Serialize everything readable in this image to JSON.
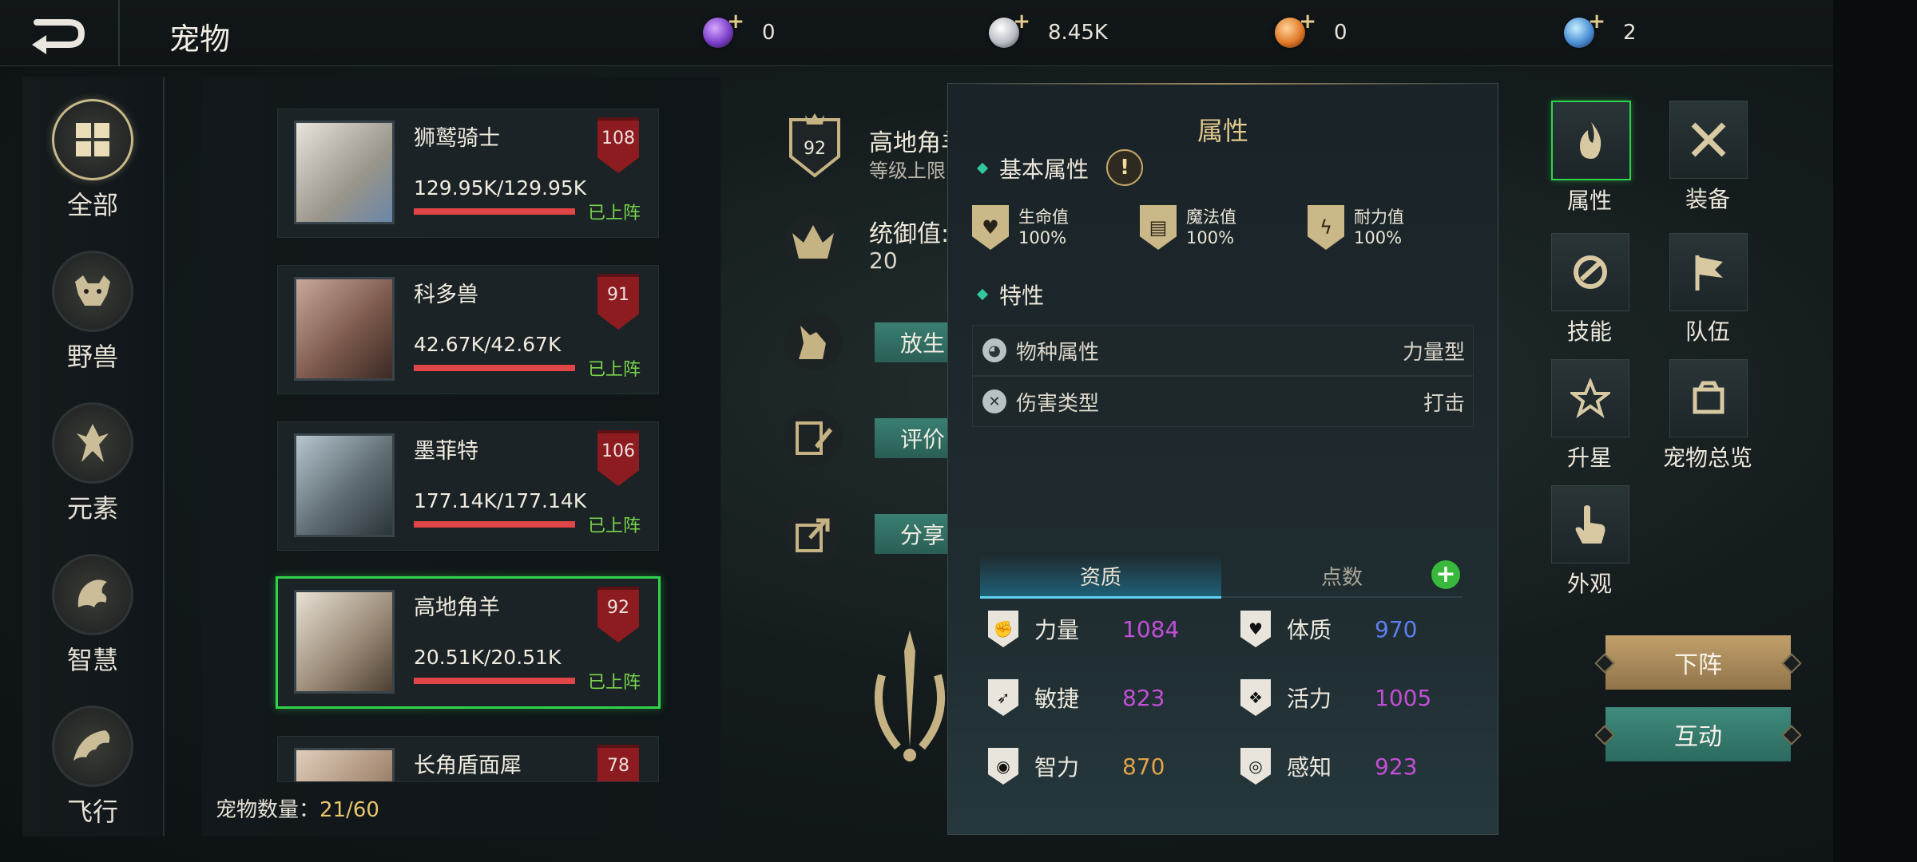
{
  "header": {
    "title": "宠物",
    "resources": [
      {
        "icon": "purple-gem-icon",
        "value": "0",
        "color": "#7b3fc9"
      },
      {
        "icon": "silver-coin-icon",
        "value": "8.45K",
        "color": "#b9bdc4"
      },
      {
        "icon": "orange-gem-icon",
        "value": "0",
        "color": "#e07a2a"
      },
      {
        "icon": "blue-crystal-icon",
        "value": "2",
        "color": "#4c8fd6"
      }
    ],
    "plus": "+"
  },
  "categories": [
    {
      "label": "全部",
      "icon": "grid-icon"
    },
    {
      "label": "野兽",
      "icon": "beast-icon"
    },
    {
      "label": "元素",
      "icon": "element-icon"
    },
    {
      "label": "智慧",
      "icon": "wisdom-icon"
    },
    {
      "label": "飞行",
      "icon": "flying-icon"
    }
  ],
  "pets": [
    {
      "name": "狮鹫骑士",
      "hp": "129.95K/129.95K",
      "level": "108",
      "status": "已上阵",
      "color": "#c9c5b8"
    },
    {
      "name": "科多兽",
      "hp": "42.67K/42.67K",
      "level": "91",
      "status": "已上阵",
      "color": "#8a6a5a"
    },
    {
      "name": "墨菲特",
      "hp": "177.14K/177.14K",
      "level": "106",
      "status": "已上阵",
      "color": "#6f7a7c"
    },
    {
      "name": "高地角羊",
      "hp": "20.51K/20.51K",
      "level": "92",
      "status": "已上阵",
      "color": "#9c8c7a"
    },
    {
      "name": "长角盾面犀",
      "level": "78",
      "color": "#a88d76"
    }
  ],
  "pet_count": {
    "label": "宠物数量：",
    "value": "21/60"
  },
  "detail": {
    "level": "92",
    "name": "高地角羊",
    "level_cap": "等级上限",
    "command_label": "统御值:",
    "command_value": "20",
    "buttons": {
      "release": "放生",
      "review": "评价",
      "share": "分享"
    }
  },
  "attributes_panel": {
    "title": "属性",
    "basic_title": "基本属性",
    "warn": "!",
    "basic_stats": [
      {
        "name": "生命值",
        "value": "100%"
      },
      {
        "name": "魔法值",
        "value": "100%"
      },
      {
        "name": "耐力值",
        "value": "100%"
      }
    ],
    "traits_title": "特性",
    "traits": [
      {
        "label": "物种属性",
        "value": "力量型"
      },
      {
        "label": "伤害类型",
        "value": "打击"
      }
    ],
    "tabs": [
      "资质",
      "点数"
    ],
    "tab_plus": "+",
    "aptitudes": [
      {
        "name": "力量",
        "value": "1084",
        "color": "#c24fd6"
      },
      {
        "name": "体质",
        "value": "970",
        "color": "#5c7ff0"
      },
      {
        "name": "敏捷",
        "value": "823",
        "color": "#c24fd6"
      },
      {
        "name": "活力",
        "value": "1005",
        "color": "#c24fd6"
      },
      {
        "name": "智力",
        "value": "870",
        "color": "#e0a24a"
      },
      {
        "name": "感知",
        "value": "923",
        "color": "#c24fd6"
      }
    ]
  },
  "right_menu": [
    "属性",
    "装备",
    "技能",
    "队伍",
    "升星",
    "宠物总览",
    "外观"
  ],
  "actions": {
    "unassign": "下阵",
    "interact": "互动"
  }
}
